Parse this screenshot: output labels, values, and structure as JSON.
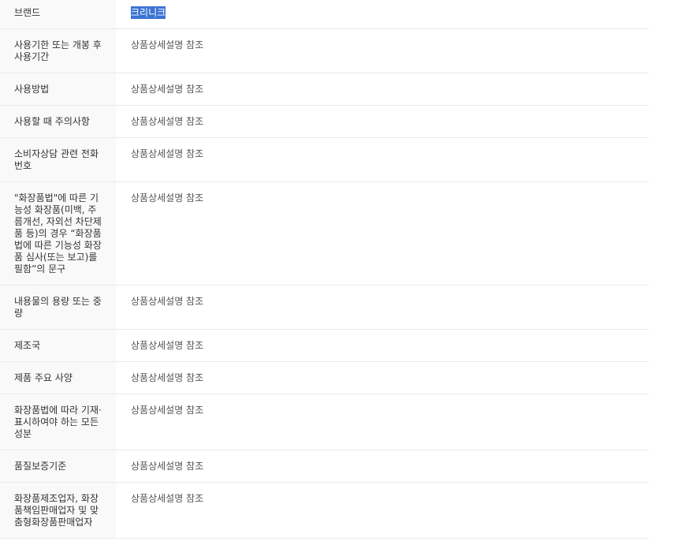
{
  "rows": [
    {
      "label": "브랜드",
      "value": "크리니크"
    },
    {
      "label": "사용기한 또는 개봉 후 사용기간",
      "value": "상품상세설명 참조"
    },
    {
      "label": "사용방법",
      "value": "상품상세설명 참조"
    },
    {
      "label": "사용할 때 주의사항",
      "value": "상품상세설명 참조"
    },
    {
      "label": "소비자상담 관련 전화번호",
      "value": "상품상세설명 참조"
    },
    {
      "label": "\"화장품법\"에 따른 기능성 화장품(미백, 주름개선, 자외선 차단제품 등)의 경우 “화장품법에 따른 기능성 화장품 심사(또는 보고)를 필함”의 문구",
      "value": "상품상세설명 참조"
    },
    {
      "label": "내용물의 용량 또는 중량",
      "value": "상품상세설명 참조"
    },
    {
      "label": "제조국",
      "value": "상품상세설명 참조"
    },
    {
      "label": "제품 주요 사양",
      "value": "상품상세설명 참조"
    },
    {
      "label": "화장품법에 따라 기재·표시하여야 하는 모든 성분",
      "value": "상품상세설명 참조"
    },
    {
      "label": "품질보증기준",
      "value": "상품상세설명 참조"
    },
    {
      "label": "화장품제조업자, 화장품책임판매업자 및 맞춤형화장품판매업자",
      "value": "상품상세설명 참조"
    }
  ]
}
